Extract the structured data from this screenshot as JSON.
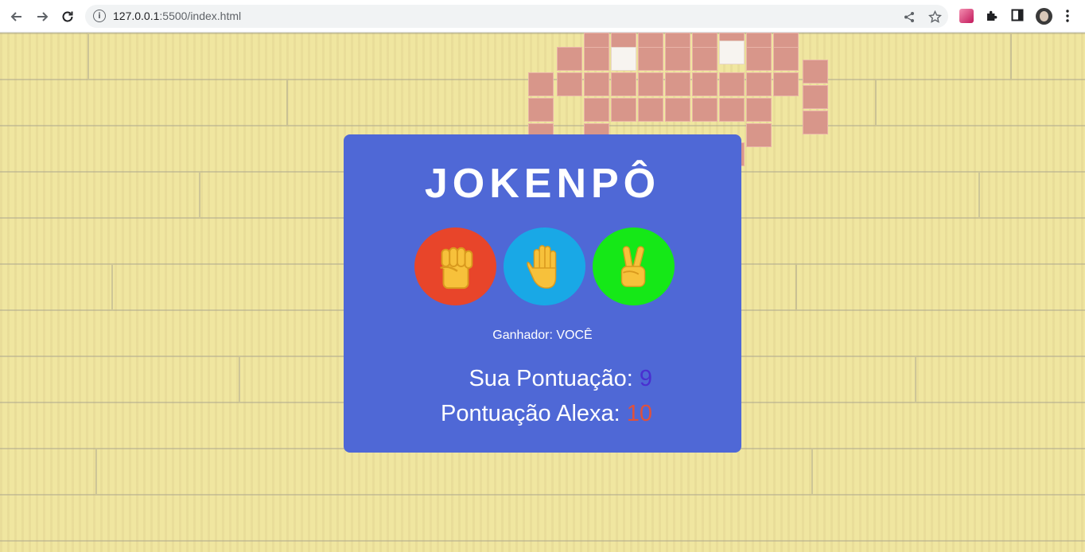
{
  "browser": {
    "url_host": "127.0.0.1",
    "url_rest": ":5500/index.html",
    "back_icon": "arrow-left-icon",
    "forward_icon": "arrow-right-icon",
    "reload_icon": "reload-icon"
  },
  "game": {
    "title": "JOKENPÔ",
    "choices": [
      {
        "name": "rock",
        "emoji": "✊",
        "color": "#e8452a"
      },
      {
        "name": "paper",
        "emoji": "🤚",
        "color": "#19a8e6"
      },
      {
        "name": "scissors",
        "emoji": "✌️",
        "color": "#15e817"
      }
    ],
    "result_text": "Ganhador: VOCÊ",
    "player_score_label": "Sua Pontuação:",
    "player_score": "9",
    "player_score_color": "#4a2fd0",
    "alexa_score_label": "Pontuação Alexa:",
    "alexa_score": "10",
    "alexa_score_color": "#e0513c",
    "card_color": "#4f68d6"
  }
}
